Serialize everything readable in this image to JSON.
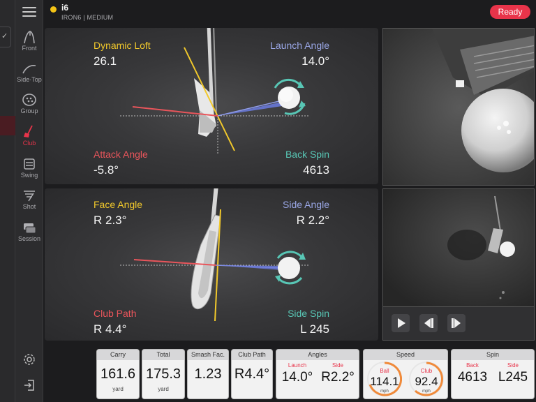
{
  "header": {
    "club_name": "i6",
    "club_details": "IRON6 | MEDIUM",
    "status": "Ready",
    "status_color": "#e8344a",
    "club_dot_color": "#f3c316"
  },
  "sidebar": {
    "items": [
      {
        "label": "Front",
        "icon": "front-view-icon"
      },
      {
        "label": "Side·Top",
        "icon": "side-top-view-icon"
      },
      {
        "label": "Group",
        "icon": "group-icon"
      },
      {
        "label": "Club",
        "icon": "club-icon",
        "active": true
      },
      {
        "label": "Swing",
        "icon": "swing-icon"
      },
      {
        "label": "Shot",
        "icon": "shot-icon"
      },
      {
        "label": "Session",
        "icon": "session-icon"
      }
    ],
    "bottom_icons": [
      "settings-icon",
      "logout-icon"
    ]
  },
  "loft_panel": {
    "dynamic_loft_label": "Dynamic Loft",
    "dynamic_loft_value": "26.1",
    "launch_angle_label": "Launch Angle",
    "launch_angle_value": "14.0°",
    "attack_angle_label": "Attack Angle",
    "attack_angle_value": "-5.8°",
    "back_spin_label": "Back Spin",
    "back_spin_value": "4613"
  },
  "face_panel": {
    "face_angle_label": "Face Angle",
    "face_angle_value": "R 2.3°",
    "side_angle_label": "Side Angle",
    "side_angle_value": "R 2.2°",
    "club_path_label": "Club Path",
    "club_path_value": "R 4.4°",
    "side_spin_label": "Side Spin",
    "side_spin_value": "L 245"
  },
  "playback": {
    "buttons": [
      "play-icon",
      "step-back-icon",
      "step-forward-icon"
    ]
  },
  "stats": {
    "carry": {
      "label": "Carry",
      "value": "161.6",
      "unit": "yard"
    },
    "total": {
      "label": "Total",
      "value": "175.3",
      "unit": "yard"
    },
    "smash": {
      "label": "Smash Fac.",
      "value": "1.23"
    },
    "club_path": {
      "label": "Club Path",
      "value": "R4.4°"
    },
    "angles": {
      "label": "Angles",
      "launch_label": "Launch",
      "launch_value": "14.0°",
      "side_label": "Side",
      "side_value": "R2.2°"
    },
    "speed": {
      "label": "Speed",
      "ball_label": "Ball",
      "ball_value": "114.1",
      "ball_unit": "mph",
      "club_label": "Club",
      "club_value": "92.4",
      "club_unit": "mph"
    },
    "spin": {
      "label": "Spin",
      "back_label": "Back",
      "back_value": "4613",
      "side_label": "Side",
      "side_value": "L245"
    }
  }
}
